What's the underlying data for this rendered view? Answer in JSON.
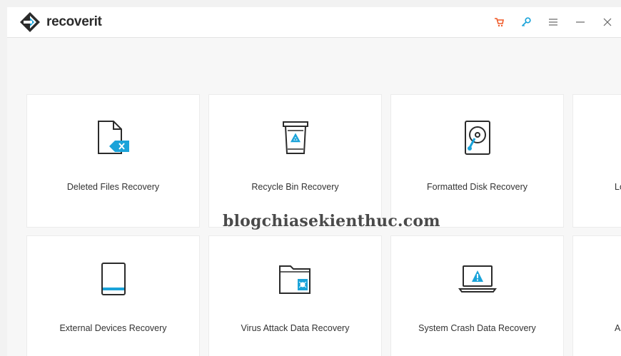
{
  "app": {
    "brand_prefix": "recover",
    "brand_suffix": "it",
    "accent_color": "#1aa3d9",
    "cart_color": "#f05a28",
    "key_color": "#1aa3d9"
  },
  "titlebar": {
    "icons": [
      "cart-icon",
      "key-icon",
      "menu-icon",
      "minimize-icon",
      "close-icon"
    ]
  },
  "cards": [
    {
      "label": "Deleted Files Recovery",
      "icon": "deleted-file-icon"
    },
    {
      "label": "Recycle Bin Recovery",
      "icon": "recycle-bin-icon"
    },
    {
      "label": "Formatted Disk Recovery",
      "icon": "formatted-disk-icon"
    },
    {
      "label": "Lo",
      "icon": ""
    },
    {
      "label": "External Devices Recovery",
      "icon": "external-device-icon"
    },
    {
      "label": "Virus Attack Data Recovery",
      "icon": "virus-folder-icon"
    },
    {
      "label": "System Crash Data Recovery",
      "icon": "system-crash-icon"
    },
    {
      "label": "A",
      "icon": ""
    }
  ],
  "watermark": "blogchiasekienthuc.com"
}
